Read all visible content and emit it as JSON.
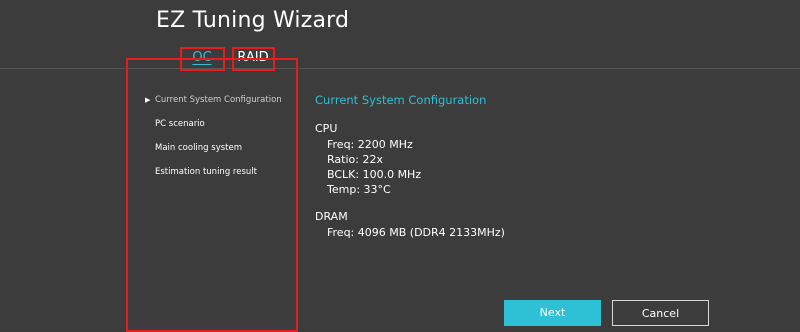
{
  "window": {
    "title": "EZ Tuning Wizard"
  },
  "tabs": [
    {
      "label": "OC",
      "active": true
    },
    {
      "label": "RAID",
      "active": false
    }
  ],
  "steps": [
    {
      "label": "Current System Configuration",
      "active": true
    },
    {
      "label": "PC scenario",
      "active": false
    },
    {
      "label": "Main cooling system",
      "active": false
    },
    {
      "label": "Estimation tuning result",
      "active": false
    }
  ],
  "active_step_icon": "triangle-right-icon",
  "content": {
    "title": "Current System Configuration",
    "cpu": {
      "label": "CPU",
      "freq": "Freq: 2200 MHz",
      "ratio": "Ratio: 22x",
      "bclk": "BCLK: 100.0 MHz",
      "temp": "Temp: 33°C"
    },
    "dram": {
      "label": "DRAM",
      "freq": "Freq: 4096 MB (DDR4 2133MHz)"
    }
  },
  "buttons": {
    "next": "Next",
    "cancel": "Cancel"
  },
  "colors": {
    "accent": "#2ec0d4",
    "highlight": "#e41e1e",
    "background": "#3c3c3c"
  }
}
